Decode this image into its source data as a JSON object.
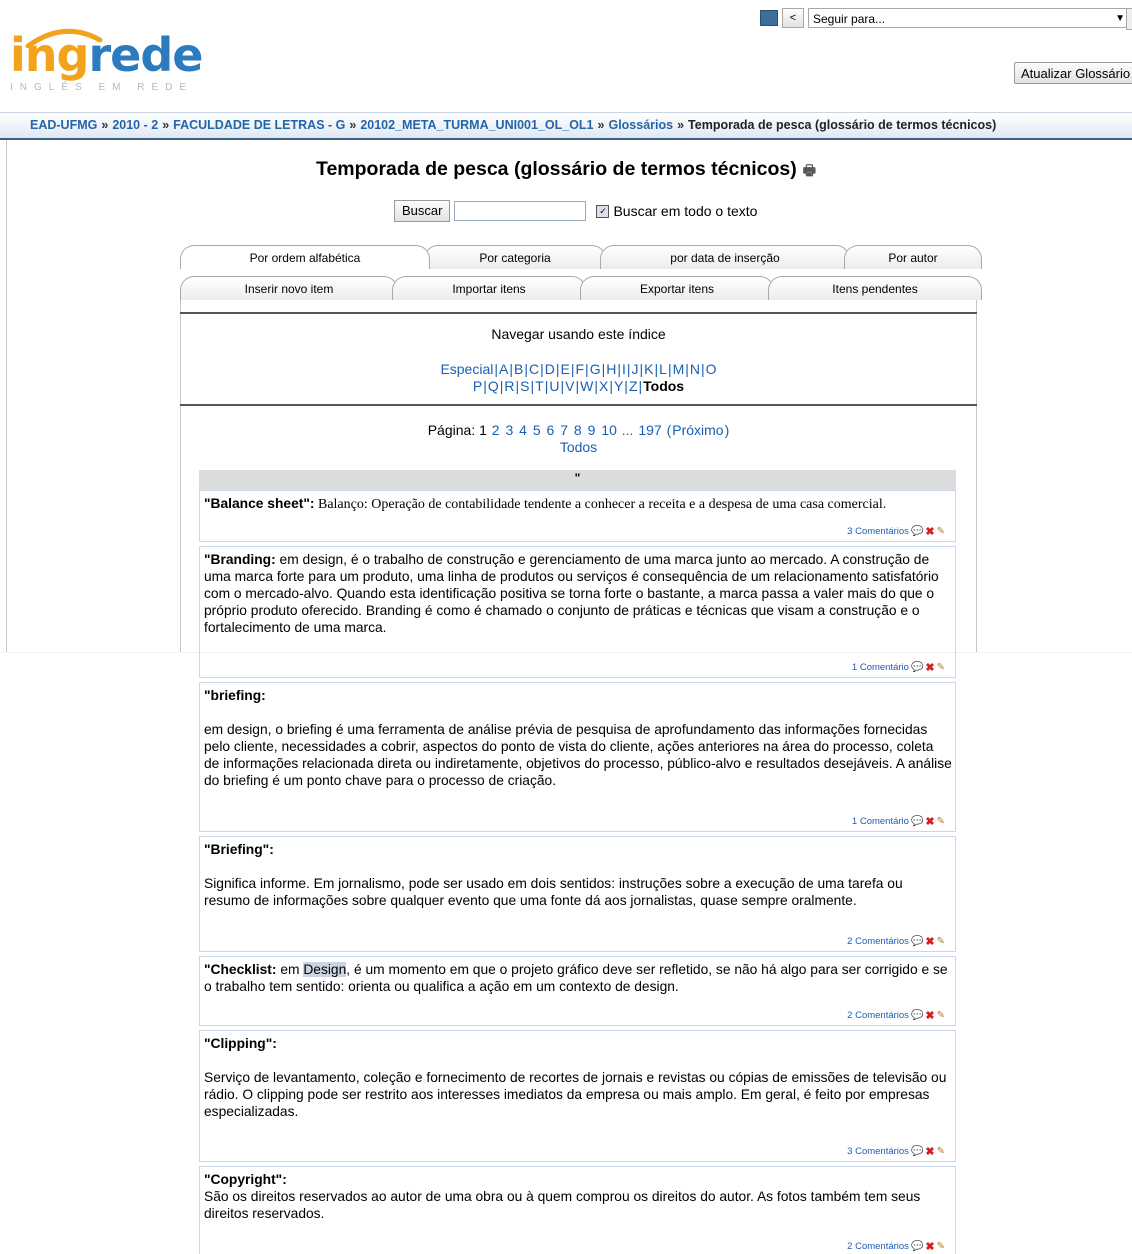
{
  "header": {
    "jump_placeholder": "Seguir para...",
    "update_button": "Atualizar Glossário",
    "prev_button": "<"
  },
  "logo": {
    "part1": "ing",
    "part2": "rede",
    "tagline": "INGLÊS EM REDE"
  },
  "breadcrumb": [
    "EAD-UFMG",
    "2010 - 2",
    "FACULDADE DE LETRAS - G",
    "20102_META_TURMA_UNI001_OL_OL1",
    "Glossários",
    "Temporada de pesca (glossário de termos técnicos)"
  ],
  "page_title": "Temporada de pesca (glossário de termos técnicos)",
  "search": {
    "button": "Buscar",
    "fulltext_label": "Buscar em todo o texto"
  },
  "tabs_row1": [
    "Por ordem alfabética",
    "Por categoria",
    "por data de inserção",
    "Por autor"
  ],
  "tabs_row2": [
    "Inserir novo item",
    "Importar itens",
    "Exportar itens",
    "Itens pendentes"
  ],
  "browse": {
    "title": "Navegar usando este índice",
    "special": "Especial",
    "letters_line1": [
      "A",
      "B",
      "C",
      "D",
      "E",
      "F",
      "G",
      "H",
      "I",
      "J",
      "K",
      "L",
      "M",
      "N",
      "O"
    ],
    "letters_line2": [
      "P",
      "Q",
      "R",
      "S",
      "T",
      "U",
      "V",
      "W",
      "X",
      "Y",
      "Z"
    ],
    "all": "Todos"
  },
  "pager": {
    "label": "Página:",
    "current": "1",
    "pages": [
      "2",
      "3",
      "4",
      "5",
      "6",
      "7",
      "8",
      "9",
      "10"
    ],
    "ellipsis": "...",
    "last": "197",
    "next": "Próximo",
    "all": "Todos"
  },
  "group_heading": "\"",
  "entries": [
    {
      "term": "\"Balance sheet\":",
      "definition": " Balanço: Operação de contabilidade tendente a conhecer a receita e a despesa de uma casa comercial.",
      "comments": "3 Comentários"
    },
    {
      "term": "\"Branding:",
      "definition": " em design, é o trabalho de construção e gerenciamento de uma marca junto ao mercado. A construção de uma marca forte para um produto, uma linha de produtos ou serviços é consequência de um relacionamento satisfatório com o mercado-alvo. Quando esta identificação positiva se torna forte o bastante, a marca passa a valer mais do que o próprio produto oferecido. Branding é como é chamado o conjunto de práticas e técnicas que visam a construção e o fortalecimento de uma marca.",
      "comments": "1 Comentário"
    },
    {
      "term": "\"briefing:",
      "definition": "em design, o briefing é uma ferramenta de análise prévia de pesquisa de aprofundamento das informações fornecidas pelo cliente, necessidades a cobrir, aspectos do ponto de vista do cliente, ações anteriores na área do processo, coleta de informações relacionada direta ou indiretamente, objetivos do processo, público-alvo e resultados desejáveis. A análise do briefing é um ponto chave para o processo de criação.",
      "comments": "1 Comentário"
    },
    {
      "term": "\"Briefing\":",
      "definition": "Significa informe. Em jornalismo, pode ser usado em dois sentidos: instruções sobre a execução de uma tarefa ou resumo de informações sobre qualquer evento que uma fonte dá aos jornalistas, quase sempre oralmente.",
      "comments": "2 Comentários"
    },
    {
      "term": "\"Checklist:",
      "definition_pre": " em ",
      "definition_highlight": "Design",
      "definition": ", é um momento em que o projeto gráfico deve ser refletido, se não há algo para ser corrigido e se o trabalho tem sentido: orienta ou qualifica a ação em um contexto de design.",
      "comments": "2 Comentários"
    },
    {
      "term": "\"Clipping\":",
      "definition": "Serviço de levantamento, coleção e fornecimento de recortes de jornais e revistas ou cópias de emissões de televisão ou rádio. O clipping pode ser restrito aos interesses imediatos da empresa ou mais amplo. Em geral, é feito por empresas especializadas.",
      "comments": "3 Comentários"
    },
    {
      "term": "\"Copyright\":",
      "definition": "São os direitos reservados ao autor de uma obra ou à quem comprou os direitos do autor. As fotos também tem seus direitos reservados.",
      "comments": "2 Comentários"
    }
  ],
  "colors": {
    "link": "#1a5fb4",
    "logo_orange": "#f2a31b",
    "logo_blue": "#2d7bbf",
    "bar_border": "#3f5f80"
  }
}
